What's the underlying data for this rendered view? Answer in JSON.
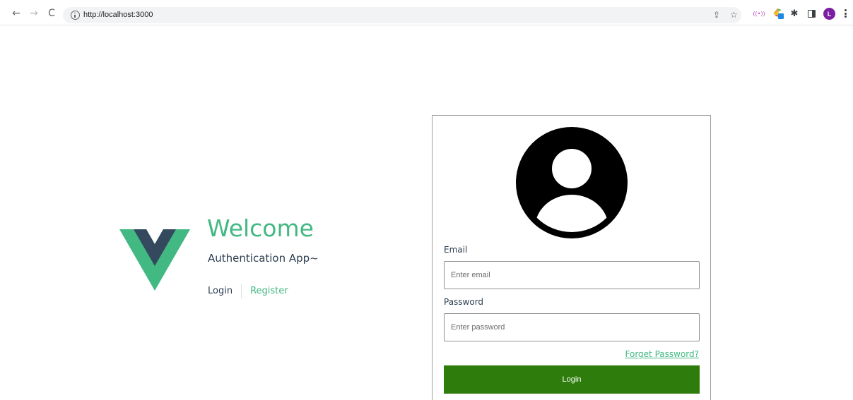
{
  "browser": {
    "url": "http://localhost:3000",
    "back_glyph": "←",
    "forward_glyph": "→",
    "reload_glyph": "C",
    "share_glyph": "⇪",
    "star_glyph": "☆",
    "radio_glyph": "((•))",
    "puzzle_glyph": "✱",
    "profile_initial": "L",
    "profile_color": "#7b1fa2",
    "icons": [
      "back-arrow",
      "forward-arrow",
      "reload",
      "info",
      "share",
      "bookmark-star",
      "radio-extension",
      "colorful-extension",
      "puzzle-extensions",
      "side-panel",
      "profile-avatar",
      "kebab-menu"
    ]
  },
  "hero": {
    "title": "Welcome",
    "subtitle": "Authentication App~",
    "nav_login": "Login",
    "nav_register": "Register",
    "accent_color": "#42b883",
    "logo_dark_color": "#35495e"
  },
  "form": {
    "email_label": "Email",
    "email_placeholder": "Enter email",
    "email_value": "",
    "password_label": "Password",
    "password_placeholder": "Enter password",
    "password_value": "",
    "forget_link": "Forget Password?",
    "submit_label": "Login",
    "submit_color": "#2e7d0c",
    "avatar_icon": "user-circle-icon"
  }
}
